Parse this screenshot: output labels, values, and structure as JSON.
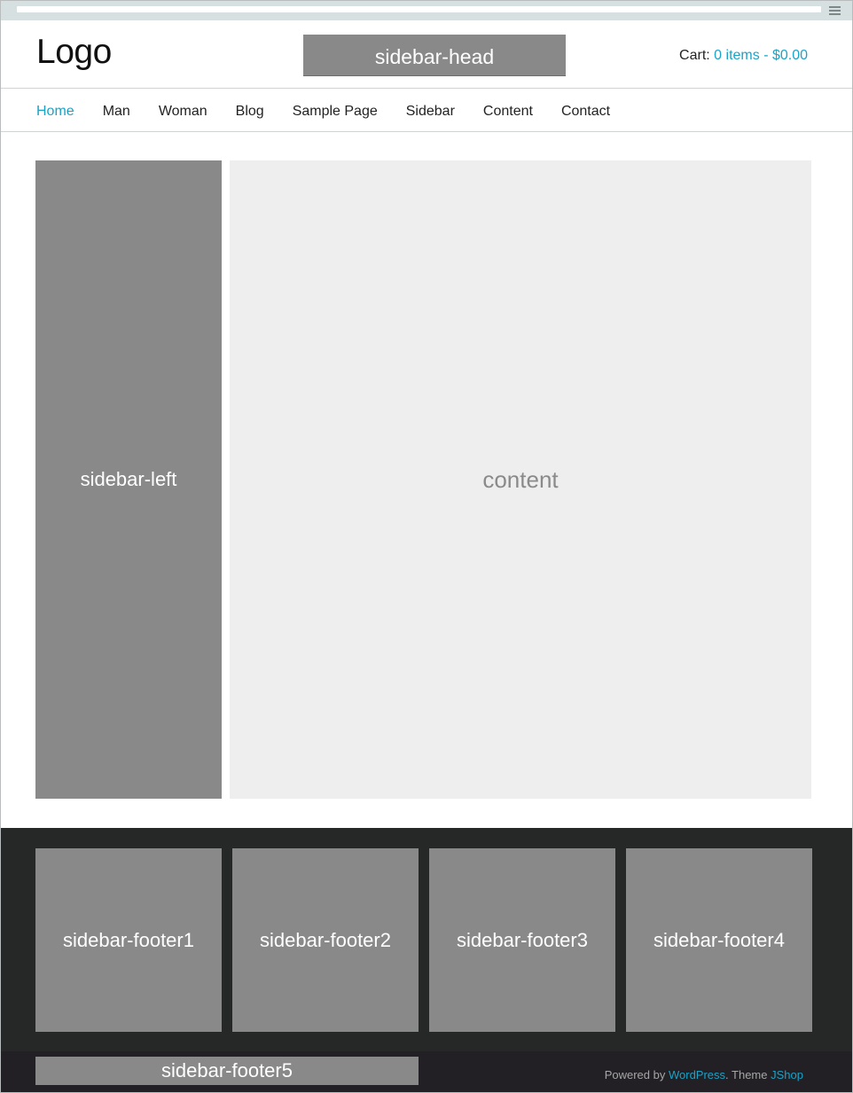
{
  "header": {
    "logo": "Logo",
    "sidebar_head": "sidebar-head",
    "cart_label": "Cart:",
    "cart_value": "0 items - $0.00"
  },
  "nav": {
    "items": [
      {
        "label": "Home",
        "active": true
      },
      {
        "label": "Man"
      },
      {
        "label": "Woman"
      },
      {
        "label": "Blog"
      },
      {
        "label": "Sample Page"
      },
      {
        "label": "Sidebar"
      },
      {
        "label": "Content"
      },
      {
        "label": "Contact"
      }
    ]
  },
  "main": {
    "sidebar_left": "sidebar-left",
    "content": "content"
  },
  "footer": {
    "boxes": [
      "sidebar-footer1",
      "sidebar-footer2",
      "sidebar-footer3",
      "sidebar-footer4"
    ],
    "footer5": "sidebar-footer5",
    "credits": {
      "powered_by": "Powered by",
      "wordpress": "WordPress",
      "separator": ". Theme",
      "theme": "JShop"
    }
  },
  "icons": {
    "menu": "hamburger-menu-icon"
  },
  "colors": {
    "accent": "#1aa3c6",
    "placeholder_block": "#898989",
    "content_bg": "#eeeeee",
    "footer_bg": "#262828",
    "bottom_bar_bg": "#221f25"
  }
}
